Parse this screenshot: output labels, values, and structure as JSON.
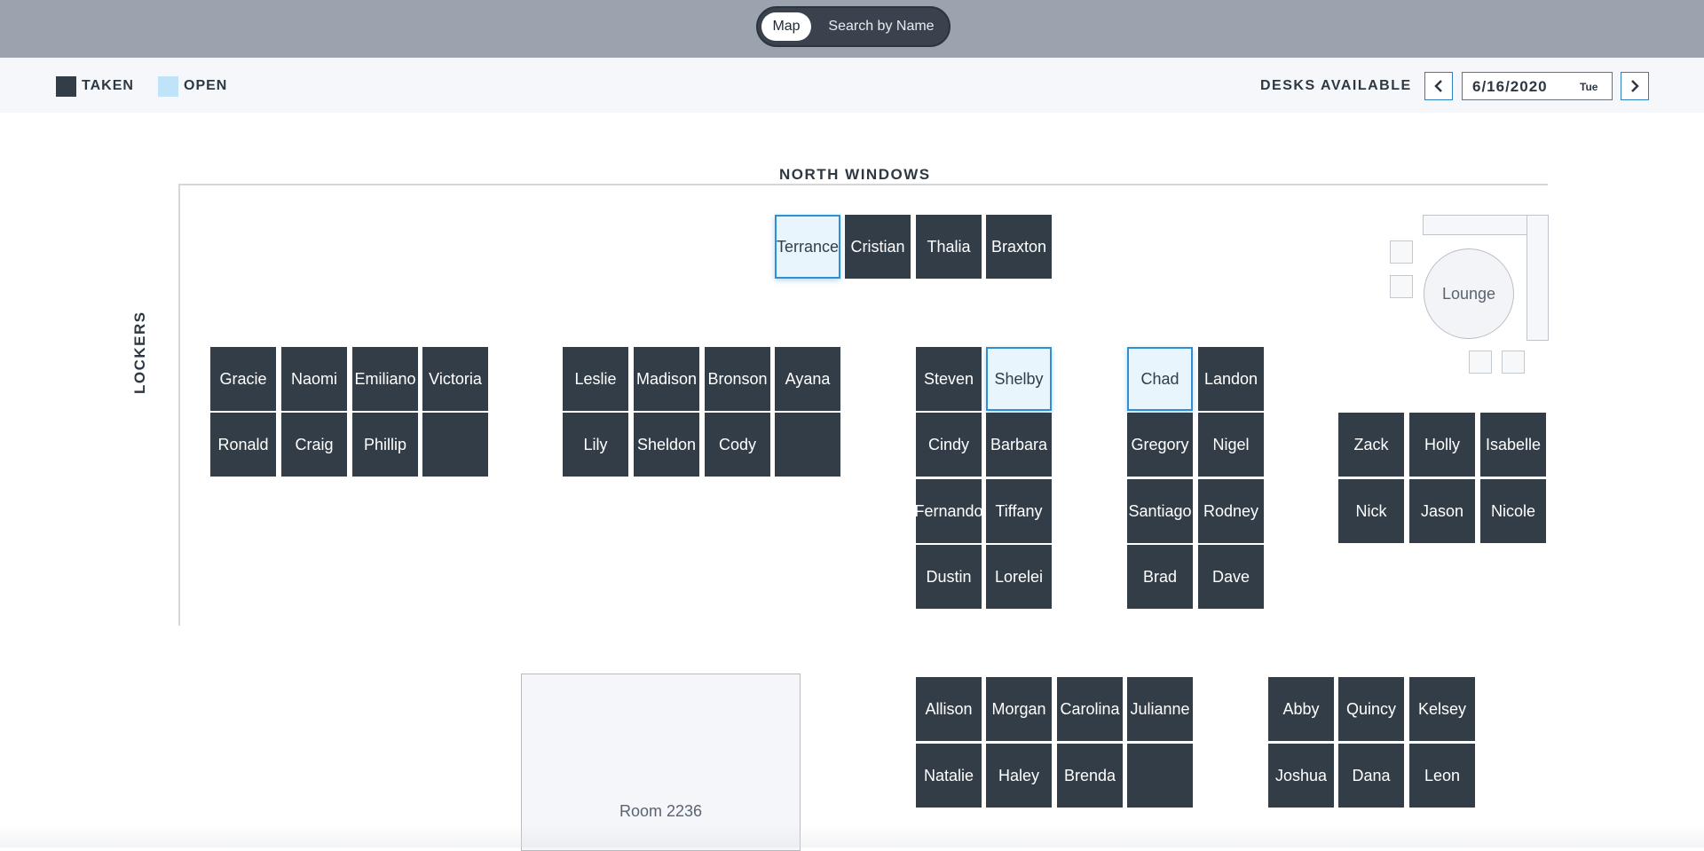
{
  "view_toggle": {
    "map_label": "Map",
    "search_label": "Search by Name"
  },
  "legend": {
    "taken_label": "TAKEN",
    "open_label": "OPEN",
    "taken_color": "#333d47",
    "open_color": "#bfe3f8"
  },
  "availability": {
    "label": "DESKS AVAILABLE",
    "date": "6/16/2020",
    "weekday": "Tue"
  },
  "areas": {
    "north_windows": "NORTH WINDOWS",
    "lockers": "LOCKERS",
    "lounge": "Lounge",
    "room": "Room 2236"
  },
  "desks": {
    "d01": {
      "name": "Terrance",
      "status": "open"
    },
    "d02": {
      "name": "Cristian",
      "status": "taken"
    },
    "d03": {
      "name": "Thalia",
      "status": "taken"
    },
    "d04": {
      "name": "Braxton",
      "status": "taken"
    },
    "d05": {
      "name": "Gracie",
      "status": "taken"
    },
    "d06": {
      "name": "Naomi",
      "status": "taken"
    },
    "d07": {
      "name": "Emiliano",
      "status": "taken"
    },
    "d08": {
      "name": "Victoria",
      "status": "taken"
    },
    "d09": {
      "name": "Ronald",
      "status": "taken"
    },
    "d10": {
      "name": "Craig",
      "status": "taken"
    },
    "d11": {
      "name": "Phillip",
      "status": "taken"
    },
    "d12": {
      "name": "",
      "status": "taken"
    },
    "d13": {
      "name": "Leslie",
      "status": "taken"
    },
    "d14": {
      "name": "Madison",
      "status": "taken"
    },
    "d15": {
      "name": "Bronson",
      "status": "taken"
    },
    "d16": {
      "name": "Ayana",
      "status": "taken"
    },
    "d17": {
      "name": "Lily",
      "status": "taken"
    },
    "d18": {
      "name": "Sheldon",
      "status": "taken"
    },
    "d19": {
      "name": "Cody",
      "status": "taken"
    },
    "d20": {
      "name": "",
      "status": "taken"
    },
    "d21": {
      "name": "Steven",
      "status": "taken"
    },
    "d22": {
      "name": "Shelby",
      "status": "open"
    },
    "d23": {
      "name": "Cindy",
      "status": "taken"
    },
    "d24": {
      "name": "Barbara",
      "status": "taken"
    },
    "d25": {
      "name": "Fernando",
      "status": "taken"
    },
    "d26": {
      "name": "Tiffany",
      "status": "taken"
    },
    "d27": {
      "name": "Dustin",
      "status": "taken"
    },
    "d28": {
      "name": "Lorelei",
      "status": "taken"
    },
    "d29": {
      "name": "Chad",
      "status": "open"
    },
    "d30": {
      "name": "Landon",
      "status": "taken"
    },
    "d31": {
      "name": "Gregory",
      "status": "taken"
    },
    "d32": {
      "name": "Nigel",
      "status": "taken"
    },
    "d33": {
      "name": "Santiago",
      "status": "taken"
    },
    "d34": {
      "name": "Rodney",
      "status": "taken"
    },
    "d35": {
      "name": "Brad",
      "status": "taken"
    },
    "d36": {
      "name": "Dave",
      "status": "taken"
    },
    "d37": {
      "name": "Zack",
      "status": "taken"
    },
    "d38": {
      "name": "Holly",
      "status": "taken"
    },
    "d39": {
      "name": "Isabelle",
      "status": "taken"
    },
    "d40": {
      "name": "Nick",
      "status": "taken"
    },
    "d41": {
      "name": "Jason",
      "status": "taken"
    },
    "d42": {
      "name": "Nicole",
      "status": "taken"
    },
    "d43": {
      "name": "Allison",
      "status": "taken"
    },
    "d44": {
      "name": "Morgan",
      "status": "taken"
    },
    "d45": {
      "name": "Carolina",
      "status": "taken"
    },
    "d46": {
      "name": "Julianne",
      "status": "taken"
    },
    "d47": {
      "name": "Natalie",
      "status": "taken"
    },
    "d48": {
      "name": "Haley",
      "status": "taken"
    },
    "d49": {
      "name": "Brenda",
      "status": "taken"
    },
    "d50": {
      "name": "",
      "status": "taken"
    },
    "d51": {
      "name": "Abby",
      "status": "taken"
    },
    "d52": {
      "name": "Quincy",
      "status": "taken"
    },
    "d53": {
      "name": "Kelsey",
      "status": "taken"
    },
    "d54": {
      "name": "Joshua",
      "status": "taken"
    },
    "d55": {
      "name": "Dana",
      "status": "taken"
    },
    "d56": {
      "name": "Leon",
      "status": "taken"
    }
  }
}
